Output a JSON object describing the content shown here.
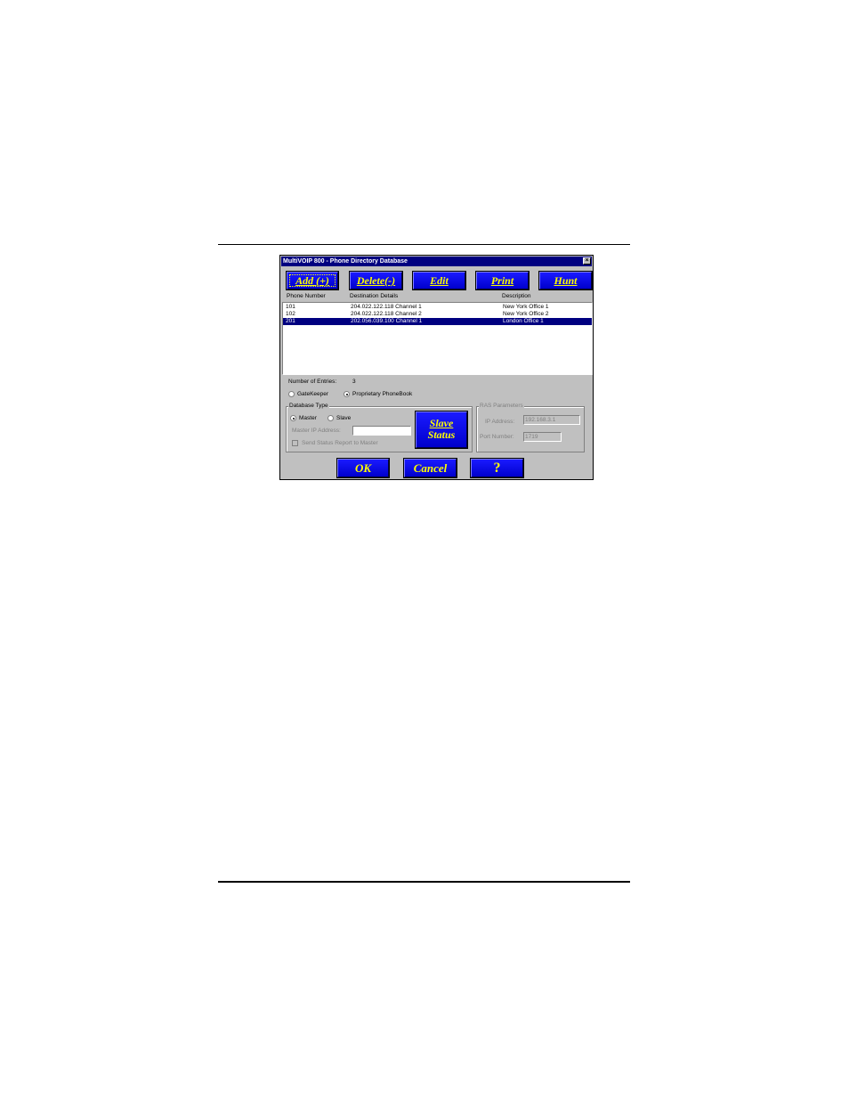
{
  "window": {
    "title": "MultiVOIP 800 - Phone Directory Database",
    "close_glyph": "×"
  },
  "toolbar": {
    "add_label": "Add (+)",
    "delete_label": "Delete(-)",
    "edit_label": "Edit",
    "print_label": "Print",
    "hunt_label": "Hunt"
  },
  "table": {
    "columns": [
      "Phone Number",
      "Destination Details",
      "Description"
    ],
    "rows": [
      {
        "phone": "101",
        "destination": "204.022.122.118 Channel 1",
        "description": "New York Office 1",
        "selected": false
      },
      {
        "phone": "102",
        "destination": "204.022.122.118 Channel 2",
        "description": "New York Office 2",
        "selected": false
      },
      {
        "phone": "201",
        "destination": "202.056.039.100 Channel 1",
        "description": "London Office 1",
        "selected": true
      }
    ]
  },
  "entries": {
    "label": "Number of Entries:",
    "count": "3"
  },
  "mode": {
    "gatekeeper_label": "GateKeeper",
    "phonebook_label": "Proprietary PhoneBook",
    "selected": "phonebook"
  },
  "database_type": {
    "group_title": "Database Type",
    "master_label": "Master",
    "slave_label": "Slave",
    "selected": "master",
    "master_ip_label": "Master IP Address:",
    "master_ip_value": "",
    "send_status_label": "Send Status Report to Master"
  },
  "slave_status": {
    "line1": "Slave",
    "line2": "Status"
  },
  "ras": {
    "group_title": "RAS Parameters",
    "ip_label": "IP Address:",
    "ip_value": "192.168.3.1",
    "port_label": "Port Number:",
    "port_value": "1719"
  },
  "footer": {
    "ok_label": "OK",
    "cancel_label": "Cancel",
    "help_label": "?"
  },
  "colors": {
    "button_blue": "#0000cc",
    "button_text": "#ffff00",
    "selection": "#000080",
    "dialog_gray": "#c0c0c0"
  }
}
